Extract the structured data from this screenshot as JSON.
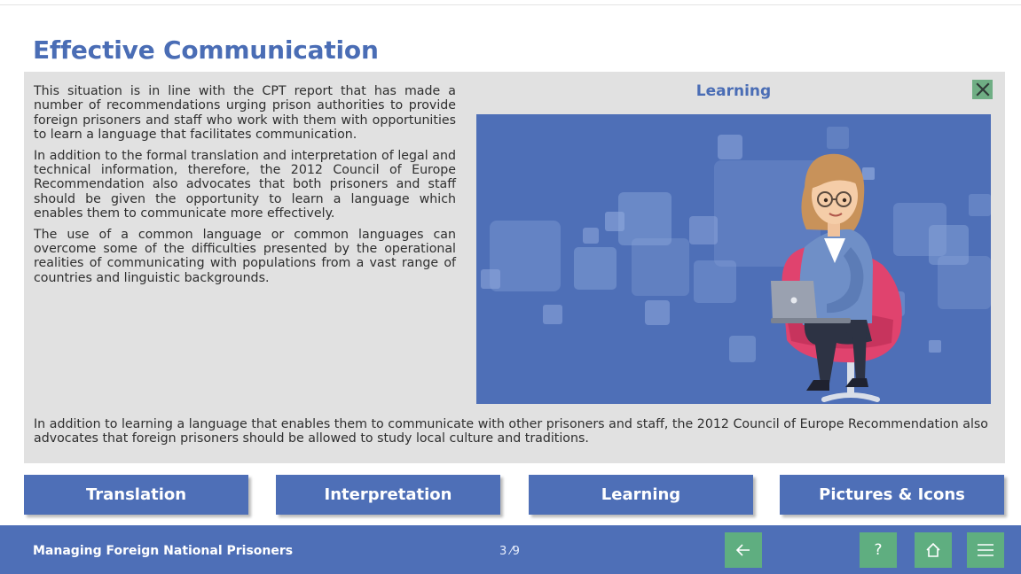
{
  "page": {
    "title": "Effective Communication"
  },
  "content": {
    "paragraphs": [
      "This situation is in line with the CPT report that has made a number of recommendations urging prison authorities to provide foreign prisoners and staff who work with them with opportunities to learn a language that facilitates communication.",
      "In addition to the formal translation and interpretation of legal and technical information, therefore, the 2012 Council of Europe Recommendation also advocates that both prisoners and staff should be given the opportunity to learn a language which enables them to communicate more effectively.",
      "The use of a common language or common languages can overcome some of the difficulties presented by the operational realities of communicating with populations from a vast range of countries and linguistic backgrounds."
    ],
    "bottom_paragraph": "In addition to learning a language that enables them to communicate with other prisoners and staff, the 2012 Council of Europe Recommendation also advocates that foreign prisoners should be allowed to study local culture and traditions."
  },
  "media": {
    "title": "Learning",
    "close_icon": "close-icon",
    "colors": {
      "background": "#4e6fb7",
      "square": "#8fa8dc",
      "chair": "#e0436e",
      "jacket": "#6f8fc7"
    }
  },
  "nav": {
    "buttons": [
      {
        "label": "Translation"
      },
      {
        "label": "Interpretation"
      },
      {
        "label": "Learning"
      },
      {
        "label": "Pictures & Icons"
      }
    ]
  },
  "footer": {
    "course_title": "Managing Foreign National Prisoners",
    "page_counter": "3 ⁄9",
    "icons": {
      "back": "arrow-left-icon",
      "help": "question-icon",
      "home": "home-icon",
      "menu": "menu-icon"
    },
    "button_color": "#5fae80"
  },
  "colors": {
    "accent": "#4a6db5",
    "panel": "#e1e1e1",
    "button": "#4e6fb7"
  }
}
